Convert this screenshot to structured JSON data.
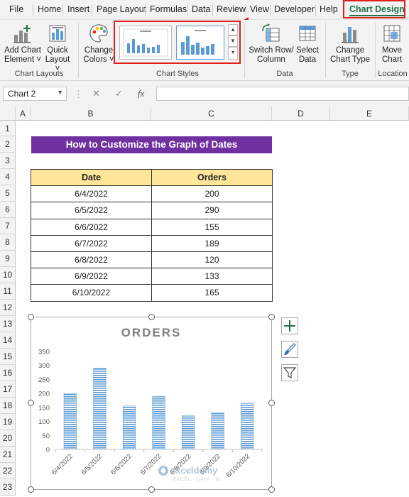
{
  "menu": {
    "tabs": [
      "File",
      "Home",
      "Insert",
      "Page Layout",
      "Formulas",
      "Data",
      "Review",
      "View",
      "Developer",
      "Help",
      "Chart Design"
    ],
    "active_tab": "Chart Design"
  },
  "ribbon": {
    "add_chart_element": "Add Chart Element",
    "add_chart_element_l1": "Add Chart",
    "add_chart_element_l2": "Element ˅",
    "quick_layout_l1": "Quick",
    "quick_layout_l2": "Layout ˅",
    "change_colors_l1": "Change",
    "change_colors_l2": "Colors ˅",
    "switch_row_l1": "Switch Row/",
    "switch_row_l2": "Column",
    "select_data_l1": "Select",
    "select_data_l2": "Data",
    "change_type_l1": "Change",
    "change_type_l2": "Chart Type",
    "move_chart_l1": "Move",
    "move_chart_l2": "Chart",
    "groups": {
      "chart_layouts": "Chart Layouts",
      "chart_styles": "Chart Styles",
      "data": "Data",
      "type": "Type",
      "location": "Location"
    }
  },
  "formula_bar": {
    "name_box": "Chart 2",
    "fx": "fx",
    "cancel": "✕",
    "enter": "✓",
    "value": ""
  },
  "grid": {
    "columns": [
      "A",
      "B",
      "C",
      "D",
      "E"
    ],
    "rows": [
      "1",
      "2",
      "3",
      "4",
      "5",
      "6",
      "7",
      "8",
      "9",
      "10",
      "11",
      "12",
      "13",
      "14",
      "15",
      "16",
      "17",
      "18",
      "19",
      "20",
      "21",
      "22",
      "23"
    ]
  },
  "sheet": {
    "title": "How to Customize the Graph of Dates",
    "table": {
      "headers": [
        "Date",
        "Orders"
      ],
      "rows": [
        [
          "6/4/2022",
          "200"
        ],
        [
          "6/5/2022",
          "290"
        ],
        [
          "6/6/2022",
          "155"
        ],
        [
          "6/7/2022",
          "189"
        ],
        [
          "6/8/2022",
          "120"
        ],
        [
          "6/9/2022",
          "133"
        ],
        [
          "6/10/2022",
          "165"
        ]
      ]
    }
  },
  "chart_data": {
    "type": "bar",
    "title": "ORDERS",
    "categories": [
      "6/4/2022",
      "6/5/2022",
      "6/6/2022",
      "6/7/2022",
      "6/8/2022",
      "6/9/2022",
      "6/10/2022"
    ],
    "values": [
      200,
      290,
      155,
      189,
      120,
      133,
      165
    ],
    "yticks": [
      "0",
      "50",
      "100",
      "150",
      "200",
      "250",
      "300",
      "350"
    ],
    "ylim": [
      0,
      350
    ],
    "xlabel": "",
    "ylabel": "",
    "grid": false,
    "legend": "none",
    "bar_color": "#5b9bd5"
  },
  "watermark": {
    "brand": "exceldemy",
    "tagline": "EXCEL · DATA · BI"
  },
  "colors": {
    "accent": "#217346",
    "highlight_red": "#e0201b",
    "title_fill": "#7030a0",
    "header_fill": "#ffe699"
  }
}
